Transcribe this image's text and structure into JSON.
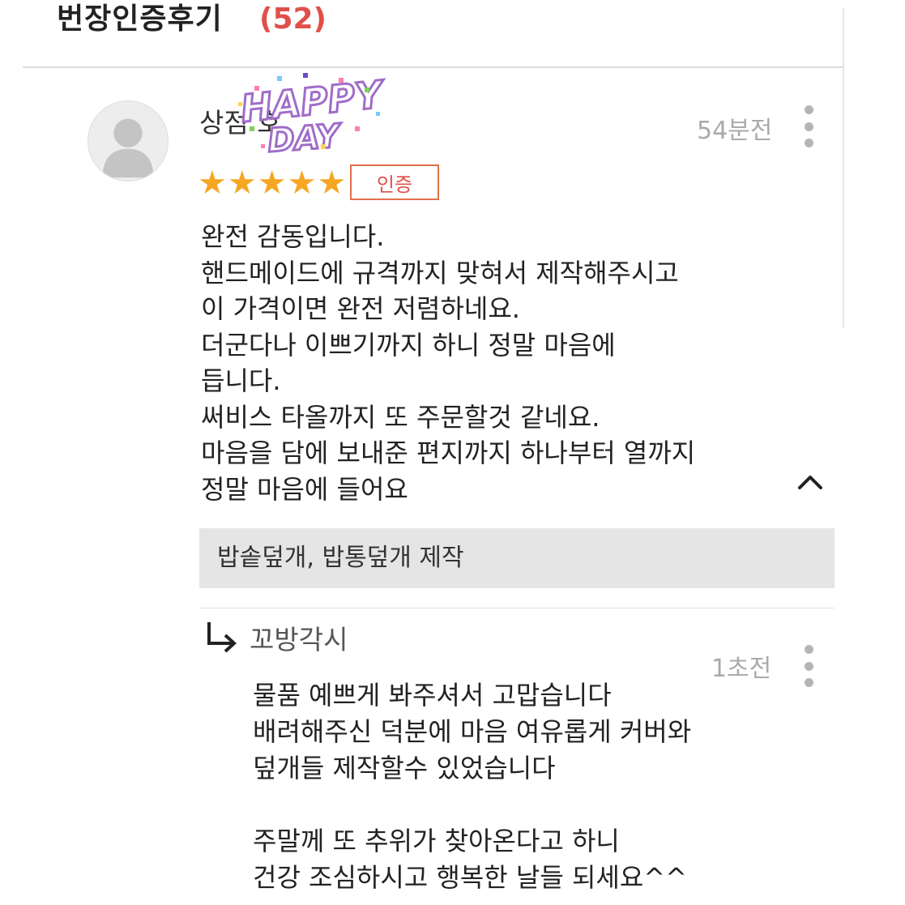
{
  "header": {
    "title": "번장인증후기",
    "count": "(52)"
  },
  "review": {
    "avatar_icon": "user-silhouette-icon",
    "reviewer_name": "상점  호",
    "sticker_text": "HAPPY DAY",
    "time_ago": "54분전",
    "rating": 5,
    "rating_max": 5,
    "star_color": "#f5a623",
    "badge_label": "인증",
    "lines": [
      "완전 감동입니다.",
      "핸드메이드에 규격까지 맞혀서 제작해주시고",
      "이 가격이면 완전 저렴하네요.",
      "더군다나 이쁘기까지 하니 정말 마음에",
      "듭니다.",
      "써비스 타올까지 또 주문할것 같네요.",
      "마음을 담에 보내준 편지까지 하나부터 열까지",
      "정말 마음에 들어요"
    ],
    "product_option": "밥솥덮개, 밥통덮개 제작"
  },
  "reply": {
    "icon": "reply-arrow-icon",
    "name": "꼬방각시",
    "time_ago": "1초전",
    "lines": [
      "물품 예쁘게 봐주셔서 고맙습니다",
      "배려해주신 덕분에 마음 여유롭게 커버와",
      "덮개들 제작할수 있었습니다",
      "",
      "주말께 또 추위가 찾아온다고 하니",
      "건강 조심하시고 행복한 날들 되세요^^"
    ]
  },
  "colors": {
    "accent": "#e0504a",
    "muted_text": "#aaaaaa",
    "option_bg": "#e5e5e5"
  }
}
